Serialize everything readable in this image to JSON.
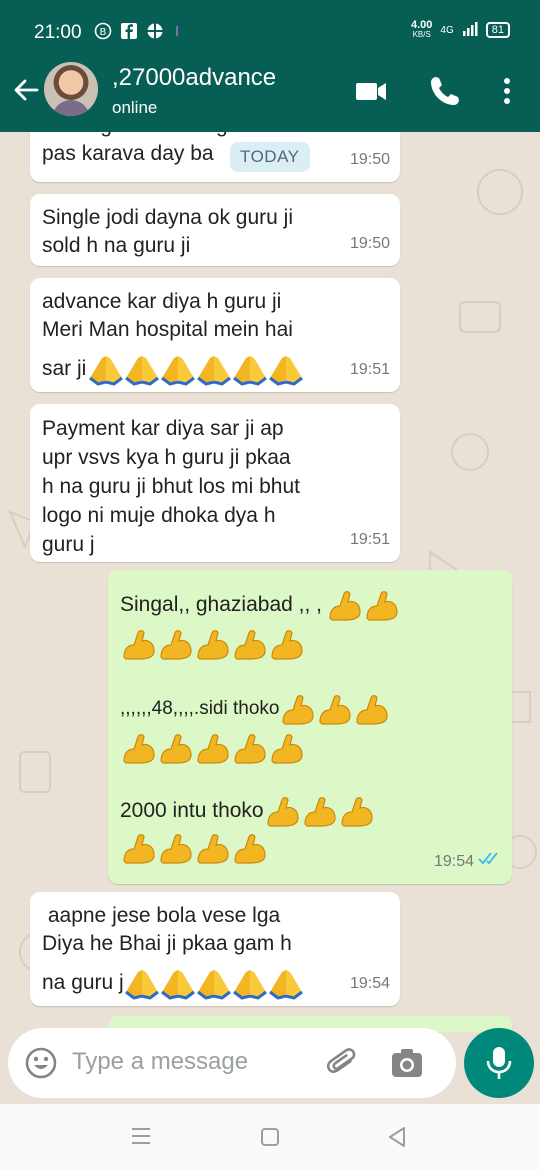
{
  "status_bar": {
    "time": "21:00",
    "net_speed": "4.00",
    "net_unit": "KB/S",
    "network": "4G",
    "battery": "81"
  },
  "header": {
    "contact_name": ",27000advance",
    "status": "online"
  },
  "date_pill": "TODAY",
  "messages": [
    {
      "dir": "in",
      "lines": [
        "banut garib h bhai game",
        "pas karava day ba        i"
      ],
      "time": "19:50"
    },
    {
      "dir": "in",
      "lines": [
        "Single jodi dayna ok guru ji",
        "sold h na guru ji"
      ],
      "time": "19:50"
    },
    {
      "dir": "in",
      "lines": [
        "advance kar diya h guru ji",
        "Meri Man hospital mein hai",
        "sar ji"
      ],
      "time": "19:51"
    },
    {
      "dir": "in",
      "lines": [
        "Payment kar diya sar ji ap",
        "upr vsvs kya h guru ji pkaa",
        "h na guru ji bhut los mi bhut",
        "logo ni muje dhoka dya h",
        "guru j"
      ],
      "time": "19:51"
    },
    {
      "dir": "out",
      "lines": [
        "Singal,, ghaziabad ,, ,",
        "",
        "",
        ",,,,,,48,,,,.sidi thoko",
        "",
        "",
        "2000 intu thoko",
        ""
      ],
      "time": "19:54"
    },
    {
      "dir": "in",
      "lines": [
        " aapne jese bola vese lga",
        "Diya he Bhai ji pkaa gam h",
        "na guru j"
      ],
      "time": "19:54"
    }
  ],
  "composer": {
    "placeholder": "Type a message"
  },
  "icons": {
    "back": "arrow-left-icon",
    "video": "video-call-icon",
    "call": "phone-icon",
    "menu": "more-vert-icon",
    "emoji": "emoji-icon",
    "attach": "paperclip-icon",
    "camera": "camera-icon",
    "mic": "mic-icon"
  },
  "colors": {
    "header": "#075e54",
    "outgoing_bubble": "#dcf8c6",
    "incoming_bubble": "#ffffff",
    "mic_button": "#00897b"
  }
}
